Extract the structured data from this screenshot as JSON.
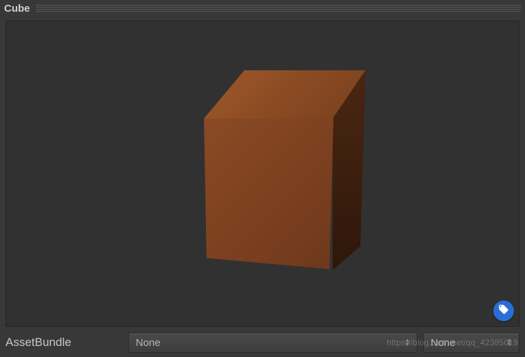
{
  "header": {
    "title": "Cube"
  },
  "preview": {
    "object_name": "cube"
  },
  "tag_button": {
    "icon": "tag-icon"
  },
  "footer": {
    "label": "AssetBundle",
    "dropdown1": {
      "value": "None"
    },
    "dropdown2": {
      "value": "None"
    }
  },
  "watermark": "https://blog.csdn.net/qq_42385019"
}
